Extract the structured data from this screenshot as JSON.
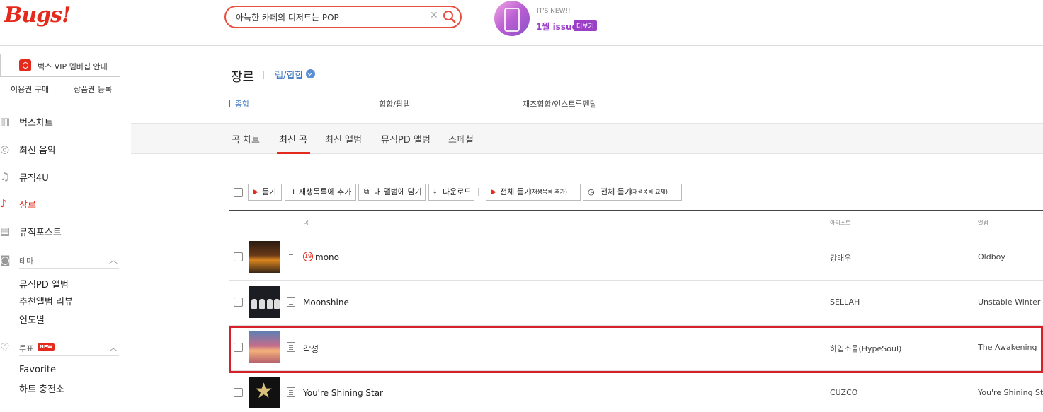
{
  "header": {
    "logo": "Bugs!",
    "search": {
      "value": "아늑한 카페의 디저트는 POP",
      "placeholder": ""
    },
    "issue": {
      "new_label": "IT'S NEW!!",
      "title": "1월 issue",
      "more": "더보기"
    }
  },
  "sidebar": {
    "vip_label": "벅스 VIP 멤버십 안내",
    "links": [
      "이용권 구매",
      "상품권 등록"
    ],
    "nav": [
      {
        "label": "벅스차트",
        "icon": "chart-icon"
      },
      {
        "label": "최신 음악",
        "icon": "disc-icon"
      },
      {
        "label": "뮤직4U",
        "icon": "music-note-icon"
      },
      {
        "label": "장르",
        "icon": "guitar-icon",
        "active": true
      },
      {
        "label": "뮤직포스트",
        "icon": "post-icon"
      }
    ],
    "theme": {
      "label": "테마",
      "items": [
        "뮤직PD 앨범",
        "추천앨범 리뷰",
        "연도별"
      ]
    },
    "vote": {
      "label": "투표",
      "badge": "NEW",
      "items": [
        "Favorite",
        "하트 충전소"
      ]
    }
  },
  "main": {
    "genre_title": "장르",
    "genre_selected": "랩/힙합",
    "subgenres": [
      "종합",
      "힙합/팝랩",
      "재즈힙합/인스트루멘탈"
    ],
    "tabs": [
      "곡 차트",
      "최신 곡",
      "최신 앨범",
      "뮤직PD 앨범",
      "스페셜"
    ],
    "active_tab": "최신 곡",
    "toolbar": {
      "listen": "듣기",
      "add_playlist": "재생목록에 추가",
      "add_album": "내 앨범에 담기",
      "download": "다운로드",
      "play_all_add": "전체 듣기",
      "play_all_add_sub": "(재생목록 추가)",
      "play_all_replace": "전체 듣기",
      "play_all_replace_sub": "(재생목록 교체)"
    },
    "columns": {
      "song": "곡",
      "artist": "아티스트",
      "album": "앨범"
    },
    "tracks": [
      {
        "title": "mono",
        "age": "19",
        "artist": "강태우",
        "album": "Oldboy"
      },
      {
        "title": "Moonshine",
        "artist": "SELLAH",
        "album": "Unstable Winter"
      },
      {
        "title": "각성",
        "artist": "하입소울(HypeSoul)",
        "album": "The Awakening"
      },
      {
        "title": "You're Shining Star",
        "artist": "CUZCO",
        "album": "You're Shining Star"
      }
    ]
  },
  "colors": {
    "brand": "#e42a1c",
    "accent_blue": "#3a76c4",
    "highlight": "#d6202a"
  }
}
